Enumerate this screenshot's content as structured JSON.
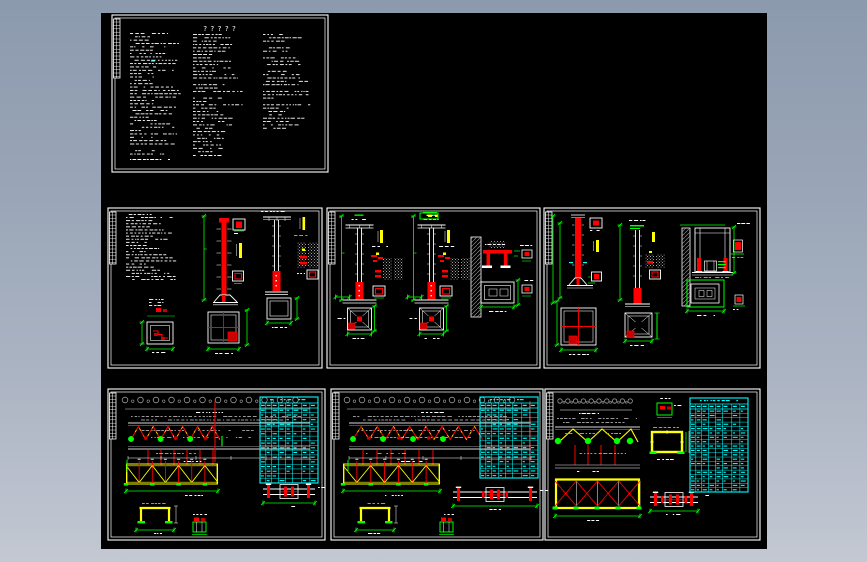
{
  "app": {
    "name": "cad-drawing-preview",
    "background_top": "#8c9aae",
    "background_bottom": "#c3c8d2",
    "canvas_color": "#000000"
  },
  "sheet": {
    "title_glyphs": "?????"
  },
  "colors": {
    "line": "#ffffff",
    "dimension": "#00ff00",
    "steel_red": "#ff0000",
    "steel_red_dark": "#c80000",
    "accent_yellow": "#ffff00",
    "table_cyan": "#00ffff",
    "muted_gray": "#9a9a9a",
    "chord_gray": "#d8d8d8"
  },
  "panels": [
    {
      "id": "general-notes-sheet"
    },
    {
      "id": "column-footing-detail-sheet-1"
    },
    {
      "id": "column-footing-detail-sheet-2"
    },
    {
      "id": "column-anchor-detail-sheet-3"
    },
    {
      "id": "truss-elevation-sheet-1"
    },
    {
      "id": "truss-elevation-sheet-2"
    },
    {
      "id": "truss-detail-sheet-3"
    }
  ]
}
